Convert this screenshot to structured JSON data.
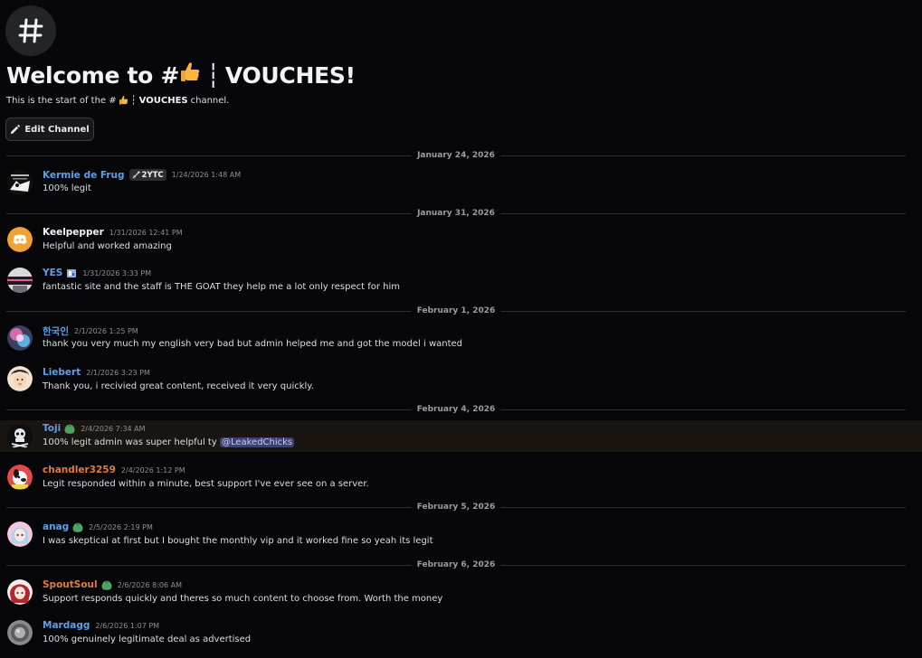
{
  "channel": {
    "welcome_prefix": "Welcome to #",
    "welcome_name": "VOUCHES!",
    "separator": "┆",
    "desc_prefix": "This is the start of the #",
    "desc_name": "VOUCHES",
    "desc_suffix": "channel.",
    "edit_button": "Edit Channel",
    "icon": "hash-icon"
  },
  "dividers": [
    "January 24, 2026",
    "January 31, 2026",
    "February 1, 2026",
    "February 4, 2026",
    "February 5, 2026",
    "February 6, 2026"
  ],
  "messages": [
    {
      "username": "Kermie de Frug",
      "tag": "2YTC",
      "timestamp": "1/24/2026 1:48 AM",
      "content": "100% legit"
    },
    {
      "username": "Keelpepper",
      "timestamp": "1/31/2026 12:41 PM",
      "content": "Helpful and worked amazing"
    },
    {
      "username": "YES",
      "timestamp": "1/31/2026 3:33 PM",
      "content": "fantastic site and the staff is THE GOAT they help me a lot only respect for him"
    },
    {
      "username": "한국인",
      "timestamp": "2/1/2026 1:25 PM",
      "content": "thank you very much my english very bad but admin helped me and got the model i wanted"
    },
    {
      "username": "Liebert",
      "timestamp": "2/1/2026 3:23 PM",
      "content": "Thank you, i recivied great content, received it very quickly."
    },
    {
      "username": "Toji",
      "timestamp": "2/4/2026 7:34 AM",
      "content": "100% legit admin was super helpful ty",
      "mention": "@LeakedChicks"
    },
    {
      "username": "chandler3259",
      "timestamp": "2/4/2026 1:12 PM",
      "content": "Legit responded within a minute, best support I've ever see on a server."
    },
    {
      "username": "anag",
      "timestamp": "2/5/2026 2:19 PM",
      "content": "I was skeptical at first but I bought the monthly vip and it worked fine so yeah its legit"
    },
    {
      "username": "SpoutSoul",
      "timestamp": "2/6/2026 8:06 AM",
      "content": "Support responds quickly and theres so much content to choose from. Worth the money"
    },
    {
      "username": "Mardagg",
      "timestamp": "2/6/2026 1:07 PM",
      "content": "100% genuinely legitimate deal as advertised"
    }
  ],
  "colors": {
    "background": "#070709",
    "username_blue": "#5ca0e8",
    "username_orange": "#e07d3a",
    "mention_bg": "#3c4270",
    "highlight_bg": "#1a1510"
  }
}
